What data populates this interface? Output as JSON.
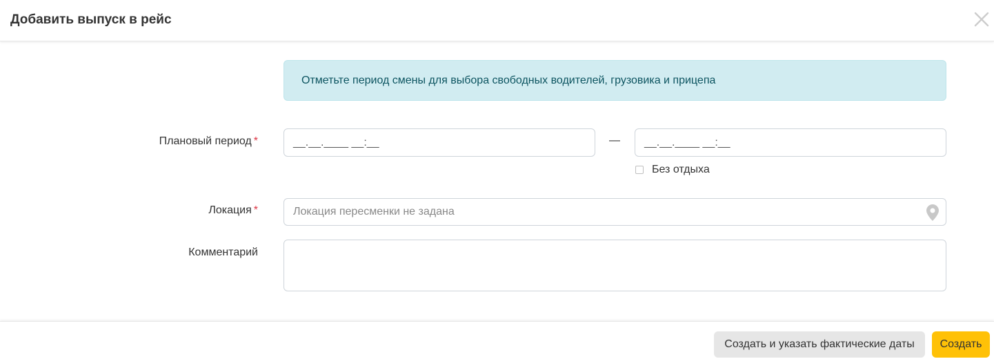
{
  "modal": {
    "title": "Добавить выпуск в рейс"
  },
  "info": {
    "message": "Отметьте период смены для выбора свободных водителей, грузовика и прицепа"
  },
  "form": {
    "planned_period": {
      "label": "Плановый период",
      "required_mark": "*",
      "start_value": "__.__.____ __:__",
      "separator": "—",
      "end_value": "__.__.____ __:__"
    },
    "no_rest": {
      "label": "Без отдыха",
      "checked": false
    },
    "location": {
      "label": "Локация",
      "required_mark": "*",
      "placeholder": "Локация пересменки не задана"
    },
    "comment": {
      "label": "Комментарий",
      "value": ""
    }
  },
  "footer": {
    "create_with_dates_label": "Создать и указать фактические даты",
    "create_label": "Создать"
  },
  "colors": {
    "primary_button": "#ffc107",
    "secondary_button": "#e6e6e6",
    "info_background": "#d1ecf1",
    "info_text": "#0c5460",
    "required": "#dc3545"
  },
  "icons": {
    "close": "close-icon",
    "location": "map-pin-icon"
  }
}
